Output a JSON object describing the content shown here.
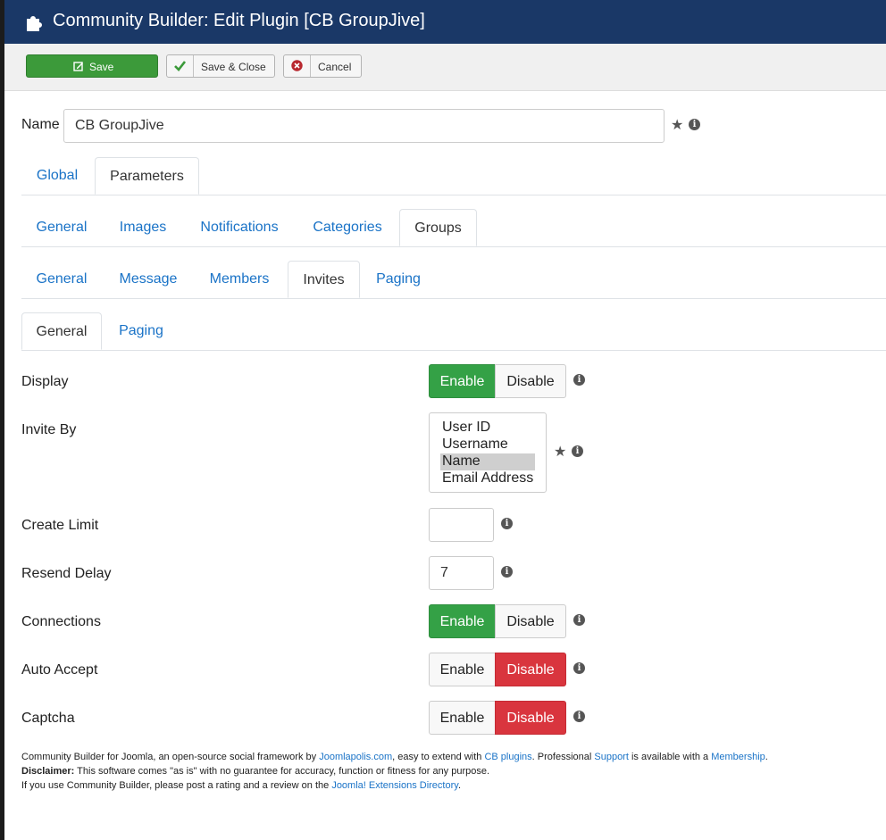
{
  "header": {
    "title": "Community Builder: Edit Plugin [CB GroupJive]",
    "icon": "puzzle-icon"
  },
  "toolbar": {
    "save": "Save",
    "save_close": "Save & Close",
    "cancel": "Cancel"
  },
  "name_field": {
    "label": "Name",
    "value": "CB GroupJive"
  },
  "tabs_level1": [
    "Global",
    "Parameters"
  ],
  "tabs_level2": [
    "General",
    "Images",
    "Notifications",
    "Categories",
    "Groups"
  ],
  "tabs_level3": [
    "General",
    "Message",
    "Members",
    "Invites",
    "Paging"
  ],
  "tabs_level4": [
    "General",
    "Paging"
  ],
  "fields": {
    "display": {
      "label": "Display",
      "enable": "Enable",
      "disable": "Disable",
      "state": "enable"
    },
    "invite_by": {
      "label": "Invite By",
      "options": [
        "User ID",
        "Username",
        "Name",
        "Email Address"
      ],
      "selected": "Name"
    },
    "create_limit": {
      "label": "Create Limit",
      "value": ""
    },
    "resend_delay": {
      "label": "Resend Delay",
      "value": "7"
    },
    "connections": {
      "label": "Connections",
      "enable": "Enable",
      "disable": "Disable",
      "state": "enable"
    },
    "auto_accept": {
      "label": "Auto Accept",
      "enable": "Enable",
      "disable": "Disable",
      "state": "disable"
    },
    "captcha": {
      "label": "Captcha",
      "enable": "Enable",
      "disable": "Disable",
      "state": "disable"
    }
  },
  "footer": {
    "l1_a": "Community Builder for Joomla, an open-source social framework by ",
    "l1_link1": "Joomlapolis.com",
    "l1_b": ", easy to extend with ",
    "l1_link2": "CB plugins",
    "l1_c": ". Professional ",
    "l1_link3": "Support",
    "l1_d": " is available with a ",
    "l1_link4": "Membership",
    "l1_e": ".",
    "l2_bold": "Disclaimer:",
    "l2_text": " This software comes \"as is\" with no guarantee for accuracy, function or fitness for any purpose.",
    "l3_a": "If you use Community Builder, please post a rating and a review on the ",
    "l3_link": "Joomla! Extensions Directory",
    "l3_b": "."
  },
  "colors": {
    "header_bg": "#1a3867",
    "enable_green": "#34a146",
    "disable_red": "#d9353e",
    "link": "#1a73c7"
  }
}
